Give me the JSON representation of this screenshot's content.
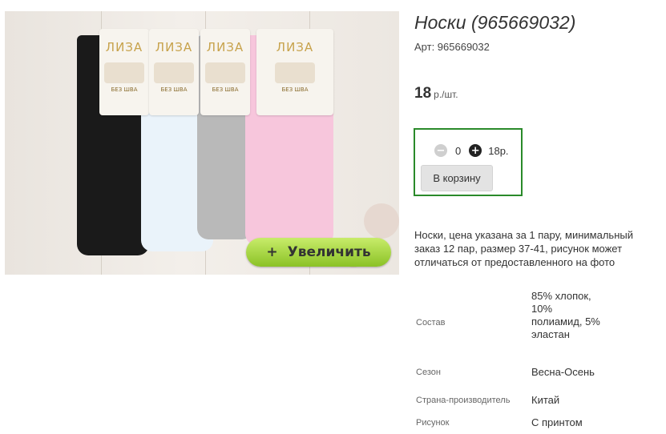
{
  "product": {
    "title": "Носки (965669032)",
    "article": "Арт: 965669032",
    "price_value": "18",
    "price_unit": "р./шт.",
    "description": "Носки, цена указана за 1 пару, минимальный заказ 12 пар, размер 37-41, рисунок может отличаться от предоставленного на фото"
  },
  "gallery": {
    "zoom_icon": "+",
    "zoom_label": "Увеличить",
    "package_brand": "ЛИЗА",
    "package_tag": "БЕЗ ШВА",
    "sock_colors": [
      "#1a1a1a",
      "#eaf3fa",
      "#b9b9b9",
      "#f7c6dc"
    ]
  },
  "cart": {
    "minus_icon": "−",
    "plus_icon": "+",
    "quantity": "0",
    "line_price": "18р.",
    "add_label": "В корзину",
    "border_color": "#2a8a2a"
  },
  "specs": [
    {
      "key": "Состав",
      "value": "85% хлопок, 10% полиамид, 5% эластан"
    },
    {
      "key": "Сезон",
      "value": "Весна-Осень"
    },
    {
      "key": "Страна-производитель",
      "value": "Китай"
    },
    {
      "key": "Рисунок",
      "value": "С принтом"
    }
  ]
}
